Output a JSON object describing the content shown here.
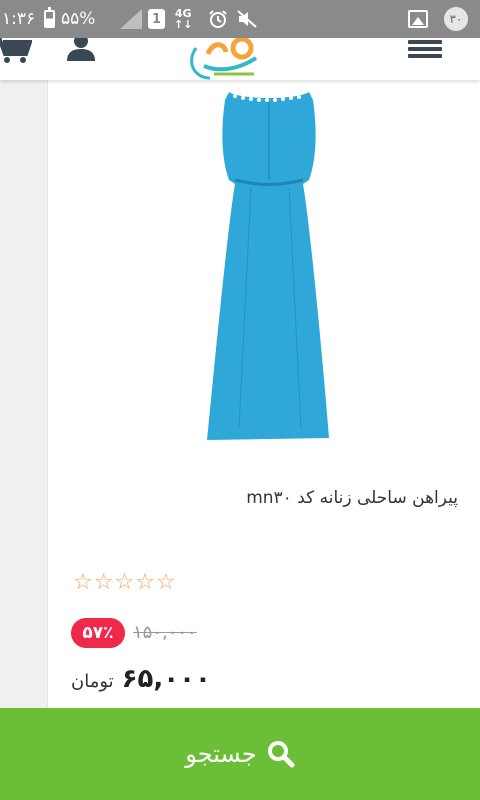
{
  "status_bar": {
    "time": "۱:۳۶",
    "battery": "۵۵%",
    "sim_slot": "1",
    "network_type": "4G",
    "network_arrows": "↑↓",
    "notification_count": "۳۰"
  },
  "header": {
    "icons": [
      "cart-icon",
      "user-icon",
      "logo",
      "menu-icon"
    ]
  },
  "product": {
    "title": "پیراهن ساحلی زنانه کد mn۳۰",
    "rating": {
      "stars": [
        "☆",
        "☆",
        "☆",
        "☆",
        "☆"
      ],
      "value": 0,
      "max": 5
    },
    "discount": "۵۷٪",
    "old_price": "۱۵۰,۰۰۰",
    "new_price": "۶۵,۰۰۰",
    "currency": "تومان"
  },
  "search_bar": {
    "label": "جستجو"
  },
  "colors": {
    "status_bar": "#8a8a8a",
    "accent_green": "#6abf36",
    "discount_red": "#f0284a",
    "star_orange": "#f5a25d",
    "dress_blue": "#2fa7d9",
    "menu_dark": "#3b4755"
  }
}
